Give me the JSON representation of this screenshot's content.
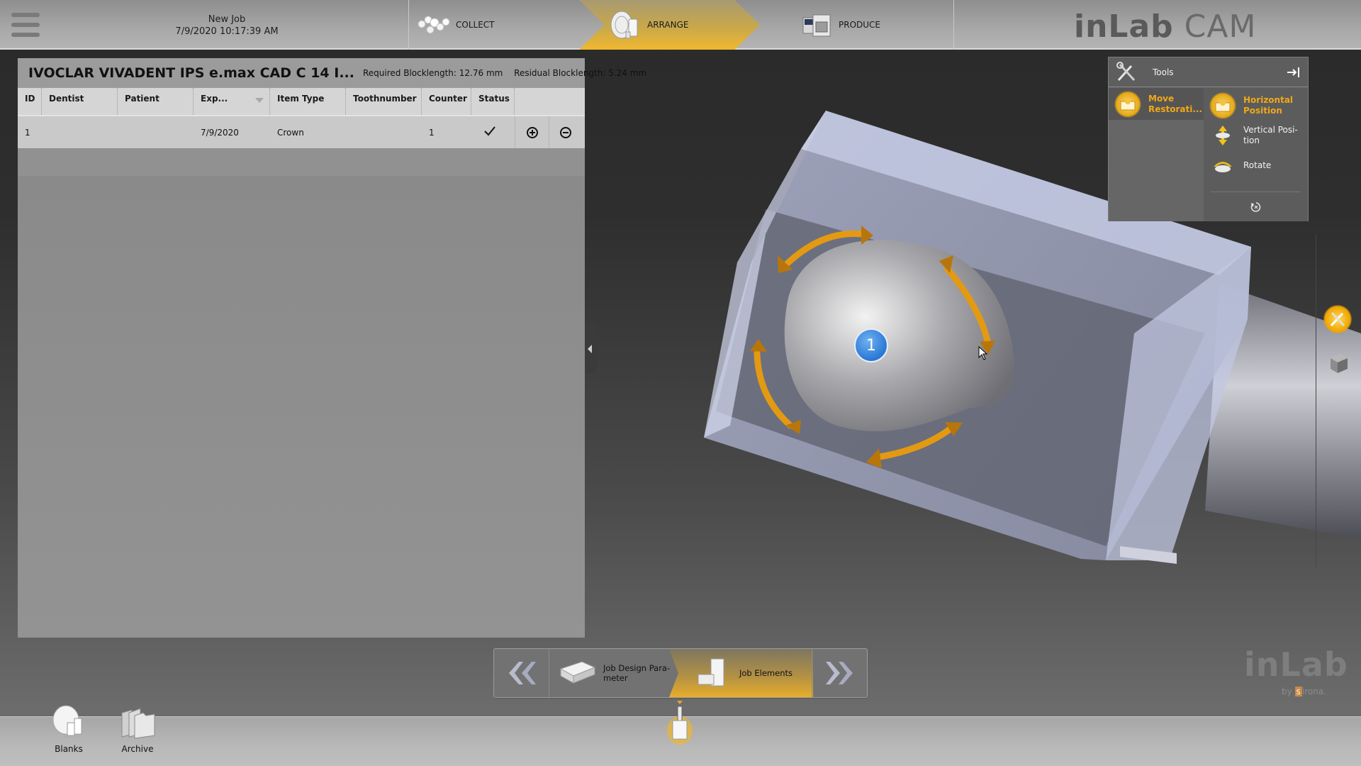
{
  "header": {
    "job_name": "New Job",
    "job_datetime": "7/9/2020 10:17:39 AM",
    "phases": [
      {
        "label": "COLLECT",
        "icon": "collect-icon",
        "active": false
      },
      {
        "label": "ARRANGE",
        "icon": "arrange-icon",
        "active": true
      },
      {
        "label": "PRODUCE",
        "icon": "produce-icon",
        "active": false
      }
    ],
    "brand_bold": "inLab",
    "brand_light": "CAM"
  },
  "job_panel": {
    "title": "IVOCLAR VIVADENT IPS e.max CAD C 14 I...",
    "required_blocklength": "Required Blocklength: 12.76 mm",
    "residual_blocklength": "Residual Blocklength: 5.24 mm",
    "columns": [
      "ID",
      "Dentist",
      "Patient",
      "Exp...",
      "Item Type",
      "Toothnumber",
      "Counter",
      "Status"
    ],
    "rows": [
      {
        "id": "1",
        "dentist": "",
        "patient": "",
        "exp": "7/9/2020",
        "item_type": "Crown",
        "toothnumber": "",
        "counter": "1",
        "status": "check"
      }
    ]
  },
  "viewport": {
    "restoration_marker": "1",
    "accent_color": "#e39a12"
  },
  "tools_panel": {
    "title": "Tools",
    "category": "Move Restorati...",
    "items": [
      {
        "label": "Horizontal Position",
        "active": true
      },
      {
        "label": "Vertical Posi-tion",
        "active": false
      },
      {
        "label": "Rotate",
        "active": false
      }
    ],
    "reset_icon": "reset-icon"
  },
  "wizard": {
    "steps": [
      {
        "label": "Job Design Para-meter",
        "active": false
      },
      {
        "label": "Job Elements",
        "active": true
      }
    ]
  },
  "dock": {
    "items": [
      {
        "label": "Blanks"
      },
      {
        "label": "Archive"
      }
    ]
  },
  "watermark": {
    "logo": "inLab",
    "by": "by",
    "company_s": "s",
    "company_rest": "irona."
  },
  "colors": {
    "accent": "#f0a818",
    "marker_blue": "#2a78d4"
  }
}
